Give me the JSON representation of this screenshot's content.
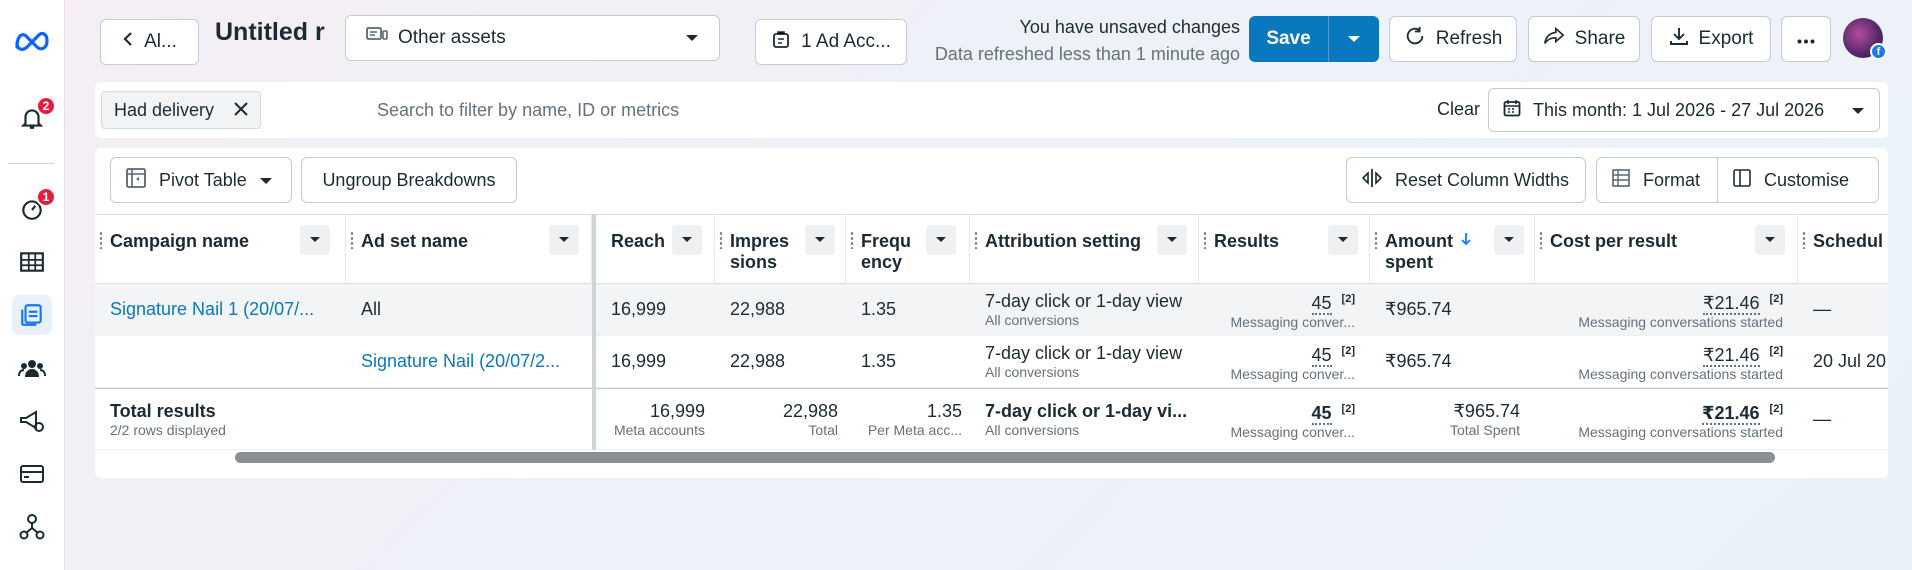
{
  "rail": {
    "notifications_badge": "2",
    "alerts_badge": "1"
  },
  "topbar": {
    "back_label": "Al...",
    "report_title": "Untitled r",
    "asset_select": "Other assets",
    "ad_account_label": "1 Ad Acc...",
    "unsaved_text": "You have unsaved changes",
    "refreshed_text": "Data refreshed less than 1 minute ago",
    "save_label": "Save",
    "refresh_label": "Refresh",
    "share_label": "Share",
    "export_label": "Export"
  },
  "filterbar": {
    "chip_label": "Had delivery",
    "search_placeholder": "Search to filter by name, ID or metrics",
    "clear_label": "Clear",
    "date_range": "This month: 1 Jul 2026 - 27 Jul 2026"
  },
  "toolbar": {
    "pivot_label": "Pivot Table",
    "ungroup_label": "Ungroup Breakdowns",
    "reset_label": "Reset Column Widths",
    "format_label": "Format",
    "customise_label": "Customise"
  },
  "columns": {
    "campaign": "Campaign name",
    "adset": "Ad set name",
    "reach": "Reach",
    "impressions": "Impres sions",
    "frequency": "Frequ ency",
    "attribution": "Attribution setting",
    "results": "Results",
    "amount": "Amount spent",
    "cpr": "Cost per result",
    "schedule": "Schedul"
  },
  "rows": [
    {
      "campaign": "Signature Nail 1 (20/07/...",
      "adset": "All",
      "reach": "16,999",
      "impressions": "22,988",
      "frequency": "1.35",
      "attribution": "7-day click or 1-day view",
      "attribution_sub": "All conversions",
      "results": "45",
      "results_sup": "[2]",
      "results_sub": "Messaging conver...",
      "amount": "₹965.74",
      "cpr": "₹21.46",
      "cpr_sup": "[2]",
      "cpr_sub": "Messaging conversations started",
      "schedule": "—"
    },
    {
      "campaign": "",
      "adset": "Signature Nail (20/07/2...",
      "reach": "16,999",
      "impressions": "22,988",
      "frequency": "1.35",
      "attribution": "7-day click or 1-day view",
      "attribution_sub": "All conversions",
      "results": "45",
      "results_sup": "[2]",
      "results_sub": "Messaging conver...",
      "amount": "₹965.74",
      "cpr": "₹21.46",
      "cpr_sup": "[2]",
      "cpr_sub": "Messaging conversations started",
      "schedule": "20 Jul 20"
    }
  ],
  "totals": {
    "label": "Total results",
    "rows_displayed": "2/2 rows displayed",
    "reach": "16,999",
    "reach_sub": "Meta accounts",
    "impressions": "22,988",
    "impressions_sub": "Total",
    "frequency": "1.35",
    "frequency_sub": "Per Meta acc...",
    "attribution": "7-day click or 1-day vi...",
    "attribution_sub": "All conversions",
    "results": "45",
    "results_sup": "[2]",
    "results_sub": "Messaging conver...",
    "amount": "₹965.74",
    "amount_sub": "Total Spent",
    "cpr": "₹21.46",
    "cpr_sup": "[2]",
    "cpr_sub": "Messaging conversations started",
    "schedule": "—"
  },
  "colors": {
    "accent": "#0a78be",
    "meta_blue": "#1877f2",
    "badge_red": "#e41e3f"
  }
}
